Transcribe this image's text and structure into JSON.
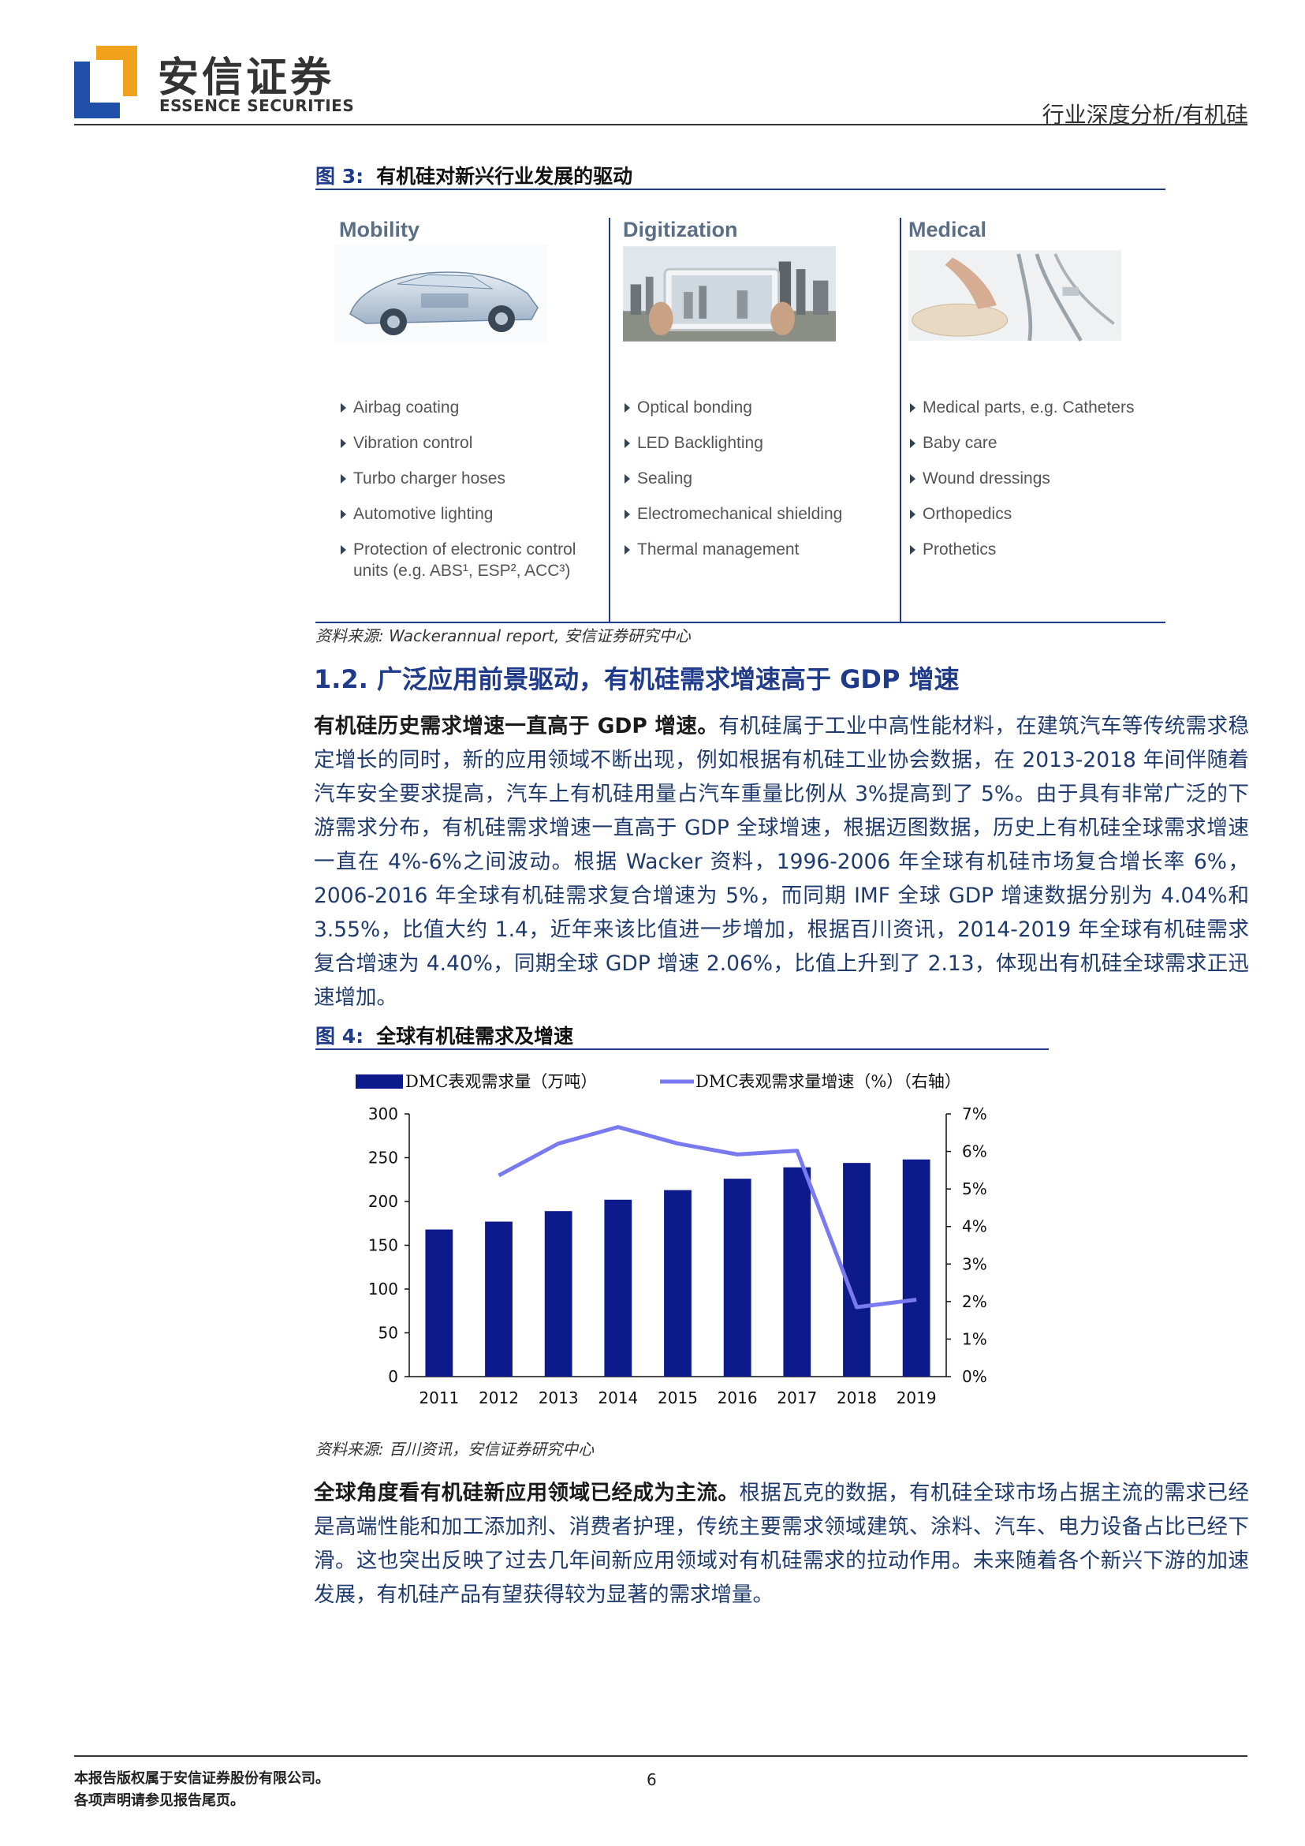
{
  "header": {
    "company_cn": "安信证券",
    "company_en": "ESSENCE SECURITIES",
    "category": "行业深度分析/有机硅"
  },
  "fig3": {
    "label": "图 3:",
    "title": "有机硅对新兴行业发展的驱动",
    "panels": [
      {
        "title": "Mobility",
        "items": [
          "Airbag coating",
          "Vibration control",
          "Turbo charger hoses",
          "Automotive lighting",
          "Protection of electronic control units (e.g. ABS¹, ESP², ACC³)"
        ]
      },
      {
        "title": "Digitization",
        "items": [
          "Optical bonding",
          "LED Backlighting",
          "Sealing",
          "Electromechanical shielding",
          "Thermal management"
        ]
      },
      {
        "title": "Medical",
        "items": [
          "Medical parts, e.g. Catheters",
          "Baby care",
          "Wound dressings",
          "Orthopedics",
          "Prothetics"
        ]
      }
    ],
    "source": "资料来源: Wackerannual report, 安信证券研究中心"
  },
  "section": {
    "number": "1.2.",
    "title": "广泛应用前景驱动，有机硅需求增速高于 GDP 增速"
  },
  "para1": {
    "lead": "有机硅历史需求增速一直高于 GDP 增速。",
    "body": "有机硅属于工业中高性能材料，在建筑汽车等传统需求稳定增长的同时，新的应用领域不断出现，例如根据有机硅工业协会数据，在 2013-2018 年间伴随着汽车安全要求提高，汽车上有机硅用量占汽车重量比例从 3%提高到了 5%。由于具有非常广泛的下游需求分布，有机硅需求增速一直高于 GDP 全球增速，根据迈图数据，历史上有机硅全球需求增速一直在 4%-6%之间波动。根据 Wacker 资料，1996-2006 年全球有机硅市场复合增长率 6%，2006-2016 年全球有机硅需求复合增速为 5%，而同期 IMF 全球 GDP 增速数据分别为 4.04%和 3.55%，比值大约 1.4，近年来该比值进一步增加，根据百川资讯，2014-2019 年全球有机硅需求复合增速为 4.40%，同期全球 GDP 增速 2.06%，比值上升到了 2.13，体现出有机硅全球需求正迅速增加。"
  },
  "fig4": {
    "label": "图 4:",
    "title": "全球有机硅需求及增速",
    "source": "资料来源: 百川资讯，安信证券研究中心"
  },
  "chart_data": {
    "type": "bar",
    "categories": [
      "2011",
      "2012",
      "2013",
      "2014",
      "2015",
      "2016",
      "2017",
      "2018",
      "2019"
    ],
    "series": [
      {
        "name": "DMC表观需求量（万吨）",
        "type": "bar",
        "axis": "left",
        "color": "#0d1a8c",
        "values": [
          168,
          177,
          189,
          202,
          213,
          226,
          239,
          244,
          248
        ]
      },
      {
        "name": "DMC表观需求量增速（%）（右轴）",
        "type": "line",
        "axis": "right",
        "color": "#7a7af0",
        "values": [
          null,
          5.36,
          6.21,
          6.65,
          6.21,
          5.92,
          6.02,
          1.85,
          2.05
        ]
      }
    ],
    "ylim": [
      0,
      300
    ],
    "y_ticks": [
      "0",
      "50",
      "100",
      "150",
      "200",
      "250",
      "300"
    ],
    "y2lim": [
      0,
      7
    ],
    "y2_ticks": [
      "0%",
      "1%",
      "2%",
      "3%",
      "4%",
      "5%",
      "6%",
      "7%"
    ],
    "legend_position": "top",
    "grid": false
  },
  "para2": {
    "lead": "全球角度看有机硅新应用领域已经成为主流。",
    "body": "根据瓦克的数据，有机硅全球市场占据主流的需求已经是高端性能和加工添加剂、消费者护理，传统主要需求领域建筑、涂料、汽车、电力设备占比已经下滑。这也突出反映了过去几年间新应用领域对有机硅需求的拉动作用。未来随着各个新兴下游的加速发展，有机硅产品有望获得较为显著的需求增量。"
  },
  "footer": {
    "line1": "本报告版权属于安信证券股份有限公司。",
    "line2": "各项声明请参见报告尾页。",
    "page": "6"
  }
}
